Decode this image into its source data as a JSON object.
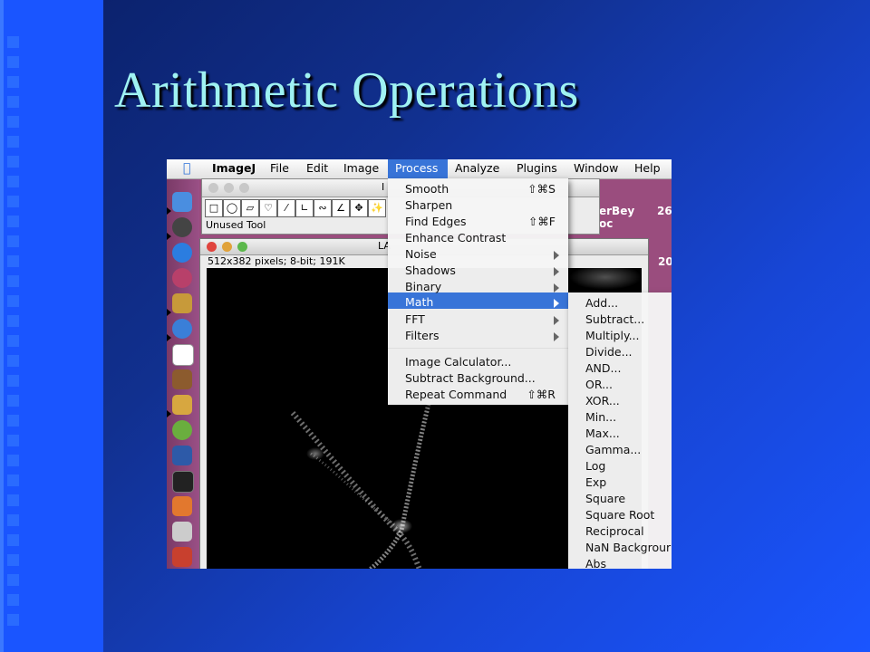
{
  "slide": {
    "title": "Arithmetic Operations"
  },
  "menubar": {
    "app": "ImageJ",
    "items": [
      "File",
      "Edit",
      "Image",
      "Process",
      "Analyze",
      "Plugins",
      "Window",
      "Help"
    ]
  },
  "toolbar_window": {
    "title_fragment": "I",
    "status": "Unused Tool"
  },
  "image_window": {
    "title_fragment": "LA",
    "info": "512x382 pixels; 8-bit; 191K"
  },
  "desktop_labels": [
    "erBey",
    "26",
    "oc",
    "20"
  ],
  "process_menu": {
    "items": [
      {
        "label": "Smooth",
        "shortcut": "⇧⌘S"
      },
      {
        "label": "Sharpen",
        "shortcut": ""
      },
      {
        "label": "Find Edges",
        "shortcut": "⇧⌘F"
      },
      {
        "label": "Enhance Contrast",
        "shortcut": ""
      },
      {
        "label": "Noise",
        "shortcut": "",
        "submenu": true
      },
      {
        "label": "Shadows",
        "shortcut": "",
        "submenu": true
      },
      {
        "label": "Binary",
        "shortcut": "",
        "submenu": true
      },
      {
        "label": "Math",
        "shortcut": "",
        "submenu": true,
        "highlighted": true
      },
      {
        "label": "FFT",
        "shortcut": "",
        "submenu": true
      },
      {
        "label": "Filters",
        "shortcut": "",
        "submenu": true
      },
      {
        "label": "Image Calculator...",
        "shortcut": ""
      },
      {
        "label": "Subtract Background...",
        "shortcut": ""
      },
      {
        "label": "Repeat Command",
        "shortcut": "⇧⌘R"
      }
    ]
  },
  "math_submenu": {
    "items": [
      "Add...",
      "Subtract...",
      "Multiply...",
      "Divide...",
      "AND...",
      "OR...",
      "XOR...",
      "Min...",
      "Max...",
      "Gamma...",
      "Log",
      "Exp",
      "Square",
      "Square Root",
      "Reciprocal",
      "NaN Backgrour",
      "Abs"
    ]
  },
  "colors": {
    "highlight": "#3874d8",
    "title": "#9ff2f2",
    "background": "#1a55ff"
  }
}
